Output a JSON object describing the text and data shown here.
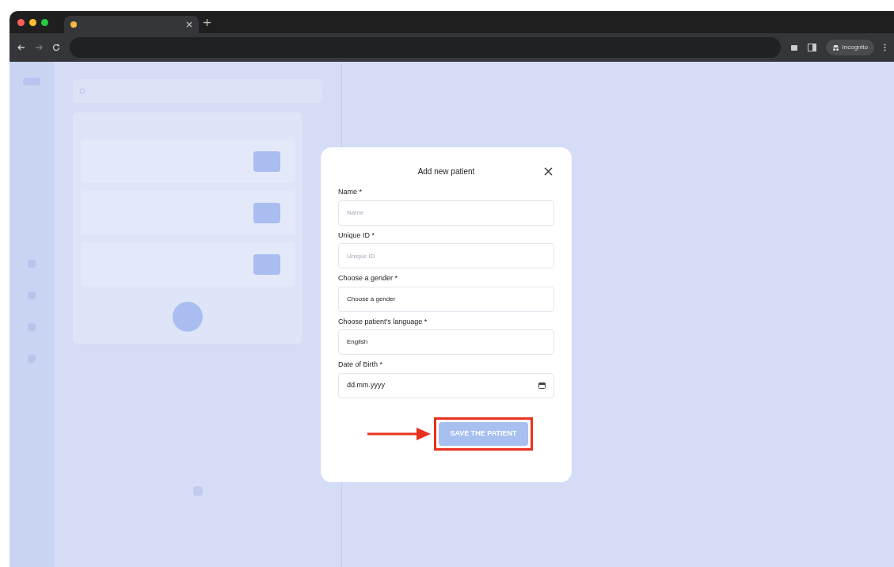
{
  "browser": {
    "incognito_label": "Incognito"
  },
  "modal": {
    "title": "Add new patient",
    "fields": [
      {
        "kind": "text",
        "label": "Name *",
        "placeholder": "Name"
      },
      {
        "kind": "text",
        "label": "Unique ID *",
        "placeholder": "Unique ID"
      },
      {
        "kind": "select",
        "label": "Choose a gender *",
        "value": "Choose a gender"
      },
      {
        "kind": "select",
        "label": "Choose patient's language *",
        "value": "English"
      },
      {
        "kind": "date",
        "label": "Date of Birth *",
        "value": "dd.mm.yyyy"
      }
    ],
    "submit": {
      "label": "SAVE THE PATIENT",
      "disabled": true,
      "highlighted": true
    }
  }
}
